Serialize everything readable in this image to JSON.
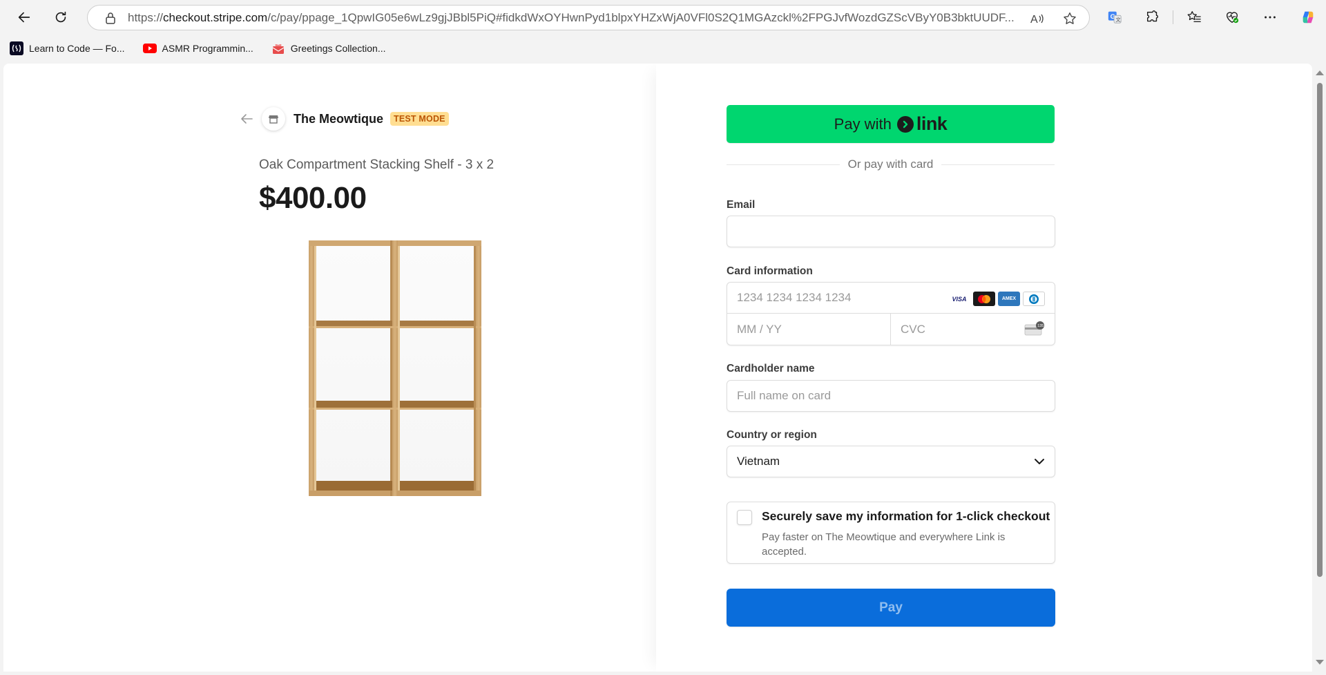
{
  "browser": {
    "url_prefix": "https://",
    "url_host": "checkout.stripe.com",
    "url_path": "/c/pay/ppage_1QpwIG05e6wLz9gjJBbl5PiQ#fidkdWxOYHwnPyd1blpxYHZxWjA0VFl0S2Q1MGAzckl%2FPGJvfWozdGZScVByY0B3bktUUDF...",
    "bookmarks": [
      {
        "label": "Learn to Code — Fo...",
        "icon": "freecodecamp-icon"
      },
      {
        "label": "ASMR Programmin...",
        "icon": "youtube-icon"
      },
      {
        "label": "Greetings Collection...",
        "icon": "greetings-icon"
      }
    ]
  },
  "merchant": {
    "name": "The Meowtique",
    "mode_badge": "TEST MODE"
  },
  "product": {
    "name": "Oak Compartment Stacking Shelf - 3 x 2",
    "price": "$400.00"
  },
  "checkout": {
    "link_button_prefix": "Pay with",
    "link_button_brand": "link",
    "divider_text": "Or pay with card",
    "email_label": "Email",
    "email_value": "",
    "card_label": "Card information",
    "card_number_placeholder": "1234 1234 1234 1234",
    "card_brands": [
      "VISA",
      "mastercard",
      "AMEX",
      "diners"
    ],
    "expiry_placeholder": "MM / YY",
    "cvc_placeholder": "CVC",
    "cvc_badge": "135",
    "cardholder_label": "Cardholder name",
    "cardholder_placeholder": "Full name on card",
    "country_label": "Country or region",
    "country_value": "Vietnam",
    "save_title": "Securely save my information for 1-click checkout",
    "save_description": "Pay faster on The Meowtique and everywhere Link is accepted.",
    "save_checked": false,
    "pay_label": "Pay"
  },
  "colors": {
    "link_green": "#00d66f",
    "pay_blue": "#0a6ddb",
    "badge_bg": "#ffde92",
    "badge_text": "#bb5504"
  }
}
